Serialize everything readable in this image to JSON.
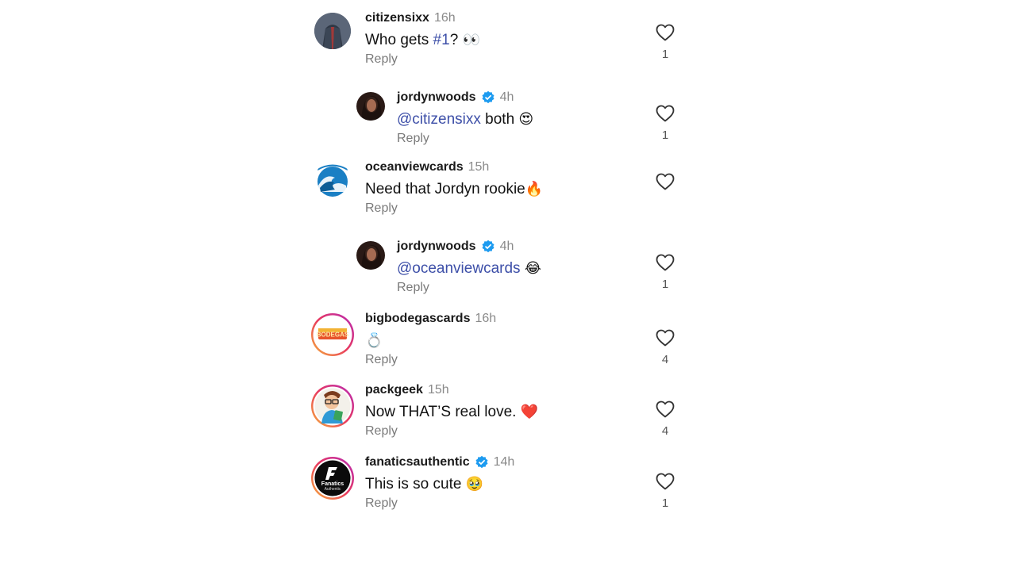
{
  "comments": [
    {
      "username": "citizensixx",
      "time": "16h",
      "text_before": "Who gets ",
      "hashtag": "#1",
      "text_after": "? ",
      "emoji": "👀",
      "reply": "Reply",
      "likes": "1",
      "verified": false
    },
    {
      "username": "jordynwoods",
      "time": "4h",
      "mention": "@citizensixx",
      "text_after": " both ",
      "emoji": "😍",
      "reply": "Reply",
      "likes": "1",
      "verified": true
    },
    {
      "username": "oceanviewcards",
      "time": "15h",
      "text_before": "Need that Jordyn rookie",
      "emoji": "🔥",
      "reply": "Reply",
      "likes": "",
      "verified": false
    },
    {
      "username": "jordynwoods",
      "time": "4h",
      "mention": "@oceanviewcards",
      "text_after": " ",
      "emoji": "😂",
      "reply": "Reply",
      "likes": "1",
      "verified": true
    },
    {
      "username": "bigbodegascards",
      "time": "16h",
      "emoji": "💍",
      "reply": "Reply",
      "likes": "4",
      "verified": false
    },
    {
      "username": "packgeek",
      "time": "15h",
      "text_before": "Now THAT’S real love. ",
      "emoji": "❤️",
      "reply": "Reply",
      "likes": "4",
      "verified": false
    },
    {
      "username": "fanaticsauthentic",
      "time": "14h",
      "text_before": "This is so cute ",
      "emoji": "🥹",
      "reply": "Reply",
      "likes": "1",
      "verified": true
    }
  ],
  "avatar_logos": {
    "bigbodegas": "BODEGAS",
    "fanatics_top": "Fanatics",
    "fanatics_bottom": "Authentic"
  },
  "icons": {
    "like": "heart-outline-icon",
    "verified": "verified-badge-icon"
  },
  "colors": {
    "link": "#3d4fa8",
    "verified": "#1d9bf0",
    "muted": "#8a8a8a",
    "story_ring": "#d8308a"
  }
}
